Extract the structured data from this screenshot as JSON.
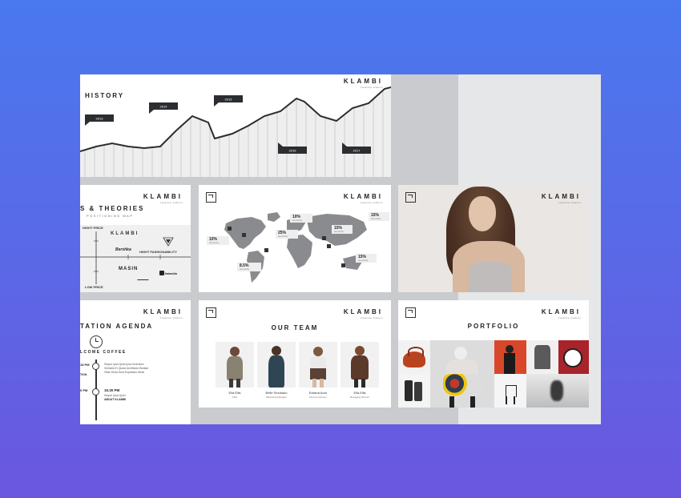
{
  "brand": {
    "name": "KLAMBI",
    "tagline": "creative station"
  },
  "history": {
    "title": "HISTORY",
    "flags": [
      "2013",
      "2014",
      "2015",
      "2016",
      "2017"
    ]
  },
  "positioning": {
    "title": "S & THEORIES",
    "subtitle": "POSITIONING MAP",
    "center_label": "KLAMBI",
    "axis_top": "HIGHT PRICE",
    "axis_bottom": "LOW PRICE",
    "axis_right": "HIGHT FASHIONABILITY",
    "brands": [
      "Bershka",
      "MASIN",
      "fatwolla"
    ]
  },
  "map_slide": {
    "labels": [
      {
        "value": "10%",
        "caption": "top country"
      },
      {
        "value": "15%",
        "caption": "top country"
      },
      {
        "value": "25%",
        "caption": "top country"
      },
      {
        "value": "10%",
        "caption": "top country"
      },
      {
        "value": "15%",
        "caption": "top country"
      },
      {
        "value": "8.5%",
        "caption": "top country"
      },
      {
        "value": "15%",
        "caption": "top country"
      }
    ]
  },
  "agenda": {
    "title": "TATION AGENDA",
    "welcome": "LCOME COFFEE",
    "item1_time": "15 PM",
    "item1_text": "Seque ipsa Quisi Ipsa Inventore Veritatis Et Quasi Architecto Beatae Vitae Dicta Sunt Explicabo Ahab",
    "item1_tag": "TION",
    "item2_time": "15.30 PM",
    "item2_text": "Seque Ipsa Quisi",
    "item2_tag": "ABOUT KLAMBI",
    "left_time": "0 PM"
  },
  "team": {
    "title": "OUR TEAM",
    "members": [
      {
        "name": "Ella Ellis",
        "role": "CEO"
      },
      {
        "name": "Belle Smokaun",
        "role": "Marketing Manager"
      },
      {
        "name": "Edwina Aron",
        "role": "Finance Director"
      },
      {
        "name": "Ella Ellis",
        "role": "Managing Director"
      }
    ]
  },
  "portfolio": {
    "title": "PORTFOLIO"
  }
}
